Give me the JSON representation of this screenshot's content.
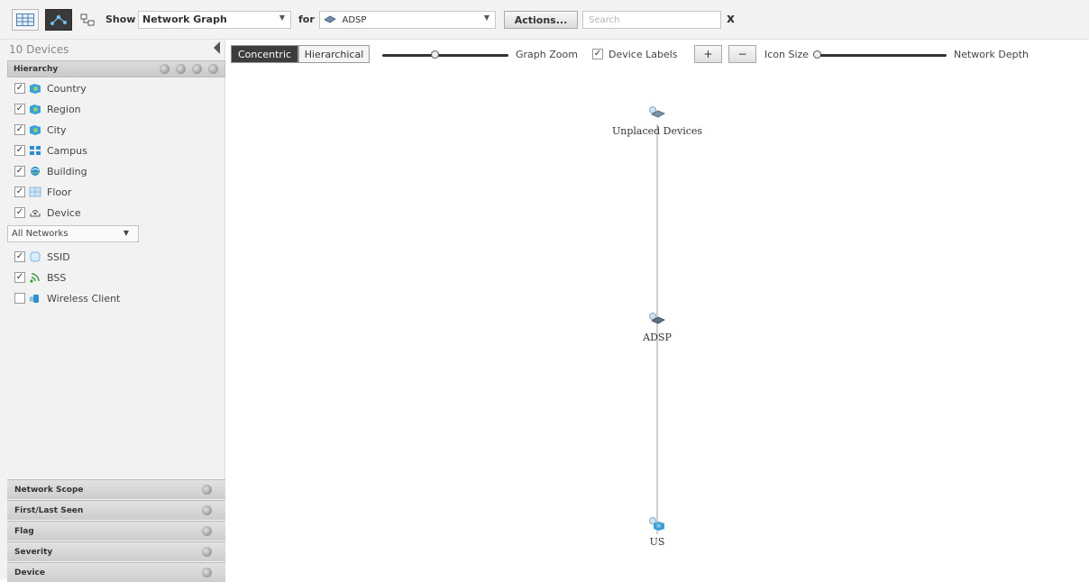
{
  "toolbar": {
    "show_label": "Show",
    "view_select": "Network Graph",
    "for_label": "for",
    "scope_select": "ADSP",
    "actions_button": "Actions...",
    "search_placeholder": "Search",
    "close_icon_text": "x"
  },
  "sidebar": {
    "device_count": "10 Devices",
    "hierarchy_title": "Hierarchy",
    "hierarchy_items": [
      {
        "label": "Country",
        "checked": true,
        "icon": "map-icon"
      },
      {
        "label": "Region",
        "checked": true,
        "icon": "map-icon"
      },
      {
        "label": "City",
        "checked": true,
        "icon": "map-icon"
      },
      {
        "label": "Campus",
        "checked": true,
        "icon": "campus-icon"
      },
      {
        "label": "Building",
        "checked": true,
        "icon": "building-icon"
      },
      {
        "label": "Floor",
        "checked": true,
        "icon": "floor-icon"
      },
      {
        "label": "Device",
        "checked": true,
        "icon": "device-icon"
      }
    ],
    "network_select": "All Networks",
    "network_items": [
      {
        "label": "SSID",
        "checked": true,
        "icon": "ssid-icon"
      },
      {
        "label": "BSS",
        "checked": true,
        "icon": "bss-icon"
      },
      {
        "label": "Wireless Client",
        "checked": false,
        "icon": "wireless-client-icon"
      }
    ],
    "filters": [
      "Network Scope",
      "First/Last Seen",
      "Flag",
      "Severity",
      "Device"
    ]
  },
  "graph_controls": {
    "layout_tabs": [
      "Concentric",
      "Hierarchical"
    ],
    "active_layout": "Concentric",
    "graph_zoom_label": "Graph Zoom",
    "device_labels_label": "Device Labels",
    "device_labels_checked": true,
    "plus_label": "+",
    "minus_label": "−",
    "icon_size_label": "Icon Size",
    "network_depth_label": "Network Depth"
  },
  "graph": {
    "nodes": [
      {
        "label": "Unplaced Devices",
        "icon": "device-group-icon"
      },
      {
        "label": "ADSP",
        "icon": "device-group-icon"
      },
      {
        "label": "US",
        "icon": "country-map-icon"
      }
    ]
  },
  "colors": {
    "accent_dark": "#3d3d3d",
    "map_blue": "#3aa0d8",
    "bss_green": "#3b9b3b"
  }
}
